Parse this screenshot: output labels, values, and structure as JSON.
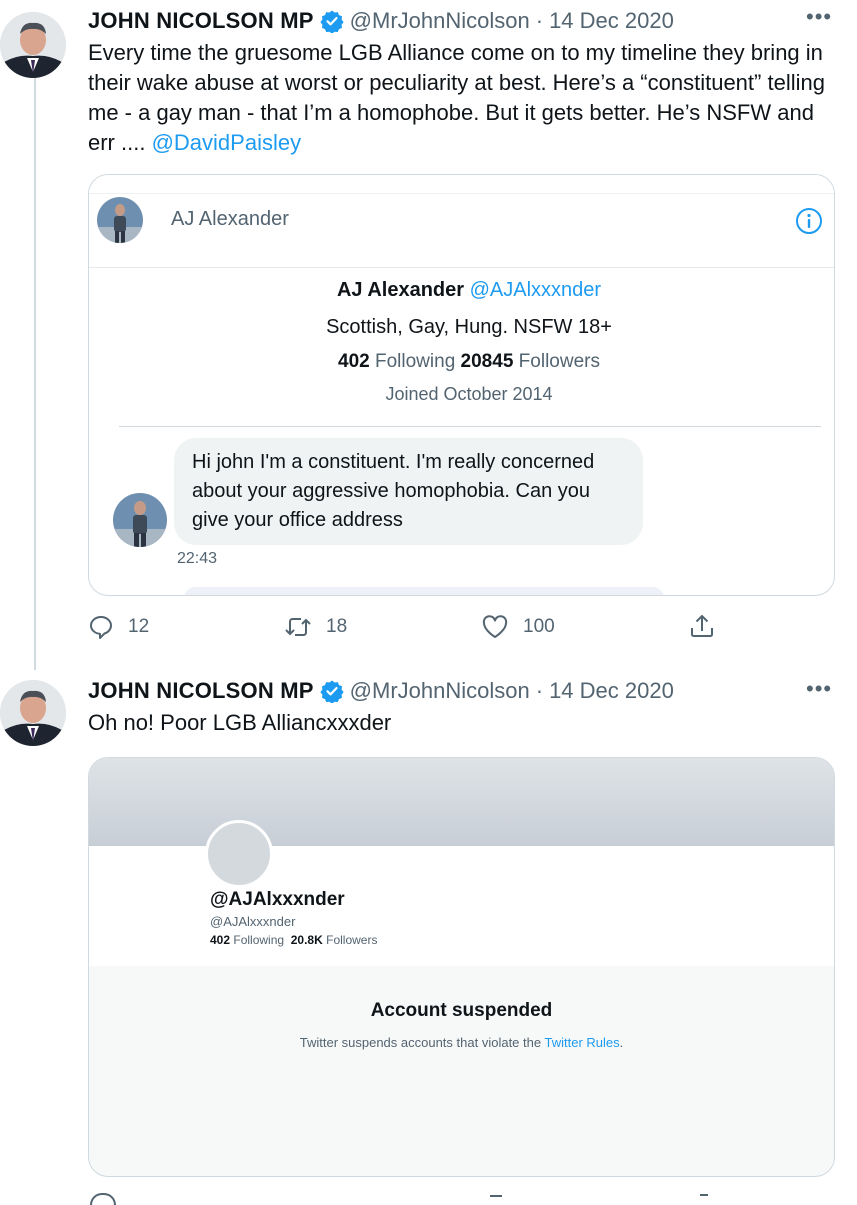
{
  "tweet1": {
    "author_name": "JOHN NICOLSON MP",
    "handle": "@MrJohnNicolson",
    "separator": "·",
    "date": "14 Dec 2020",
    "text": "Every time the gruesome LGB Alliance come on to my timeline they bring in their wake abuse at worst or peculiarity at best. Here’s a “constituent” telling me - a gay man - that I’m a homophobe. But it gets better. He’s NSFW and err ....",
    "mention": "@DavidPaisley",
    "more_icon": "more-horizontal-icon",
    "dm_card": {
      "header_name": "AJ Alexander",
      "info_icon": "info-icon",
      "profile_name": "AJ Alexander",
      "profile_handle": "@AJAlxxxnder",
      "bio": "Scottish, Gay, Hung. NSFW 18+",
      "following_count": "402",
      "following_label": "Following",
      "followers_count": "20845",
      "followers_label": "Followers",
      "joined": "Joined October 2014",
      "message": "Hi john I'm a constituent. I'm really concerned about your aggressive homophobia. Can you give your office  address",
      "message_time": "22:43"
    },
    "actions": {
      "reply_count": "12",
      "retweet_count": "18",
      "like_count": "100"
    }
  },
  "tweet2": {
    "author_name": "JOHN NICOLSON MP",
    "handle": "@MrJohnNicolson",
    "separator": "·",
    "date": "14 Dec 2020",
    "text": "Oh no! Poor LGB Alliancxxxder",
    "more_icon": "more-horizontal-icon",
    "suspended_card": {
      "display_name": "@AJAlxxxnder",
      "handle": "@AJAlxxxnder",
      "following_count": "402",
      "following_label": "Following",
      "followers_count": "20.8K",
      "followers_label": "Followers",
      "title": "Account suspended",
      "description": "Twitter suspends accounts that violate the",
      "rules_link": "Twitter Rules",
      "period": "."
    }
  },
  "colors": {
    "link": "#1d9bf0",
    "verified": "#1d9bf0",
    "muted": "#536471",
    "banner": "#c7ced6"
  }
}
